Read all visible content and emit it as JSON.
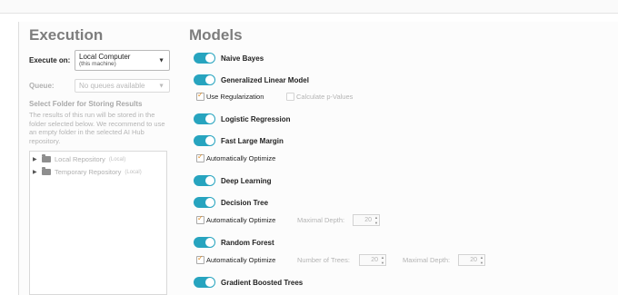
{
  "execution": {
    "title": "Execution",
    "execute_on_label": "Execute on:",
    "execute_on_value": "Local Computer",
    "execute_on_sub": "(this machine)",
    "queue_label": "Queue:",
    "queue_value": "No queues available",
    "folder_heading": "Select Folder for Storing Results",
    "folder_description": "The results of this run will be stored in the folder selected below. We recommend to use an empty folder in the selected AI Hub repository.",
    "repositories": [
      {
        "name": "Local Repository",
        "tag": "(Local)"
      },
      {
        "name": "Temporary Repository",
        "tag": "(Local)"
      }
    ]
  },
  "models": {
    "title": "Models",
    "toggle_color": "#27a4bf",
    "check_color": "#e08a1e",
    "items": [
      {
        "name": "Naive Bayes",
        "enabled": true
      },
      {
        "name": "Generalized Linear Model",
        "enabled": true,
        "use_regularization": "Use Regularization",
        "calculate_p_values": "Calculate p-Values"
      },
      {
        "name": "Logistic Regression",
        "enabled": true
      },
      {
        "name": "Fast Large Margin",
        "enabled": true,
        "automatically_optimize": "Automatically Optimize"
      },
      {
        "name": "Deep Learning",
        "enabled": true
      },
      {
        "name": "Decision Tree",
        "enabled": true,
        "automatically_optimize": "Automatically Optimize",
        "maximal_depth_label": "Maximal Depth:",
        "maximal_depth_value": "20"
      },
      {
        "name": "Random Forest",
        "enabled": true,
        "automatically_optimize": "Automatically Optimize",
        "number_of_trees_label": "Number of Trees:",
        "number_of_trees_value": "20",
        "maximal_depth_label": "Maximal Depth:",
        "maximal_depth_value": "20"
      },
      {
        "name": "Gradient Boosted Trees",
        "enabled": true
      }
    ]
  }
}
